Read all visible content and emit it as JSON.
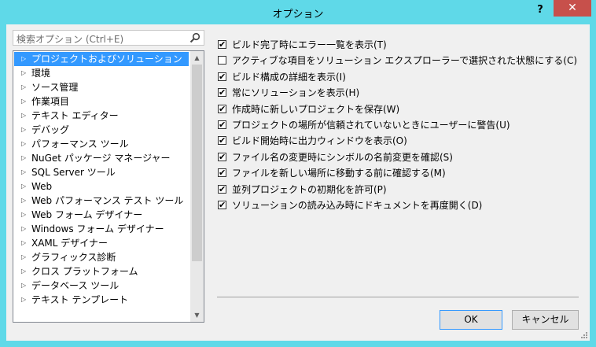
{
  "window": {
    "title": "オプション",
    "help_label": "?",
    "close_label": "✕"
  },
  "search": {
    "placeholder": "検索オプション (Ctrl+E)"
  },
  "tree": {
    "items": [
      {
        "label": "プロジェクトおよびソリューション",
        "selected": true
      },
      {
        "label": "環境"
      },
      {
        "label": "ソース管理"
      },
      {
        "label": "作業項目"
      },
      {
        "label": "テキスト エディター"
      },
      {
        "label": "デバッグ"
      },
      {
        "label": "パフォーマンス ツール"
      },
      {
        "label": "NuGet パッケージ マネージャー"
      },
      {
        "label": "SQL Server ツール"
      },
      {
        "label": "Web"
      },
      {
        "label": "Web パフォーマンス テスト ツール"
      },
      {
        "label": "Web フォーム デザイナー"
      },
      {
        "label": "Windows フォーム デザイナー"
      },
      {
        "label": "XAML デザイナー"
      },
      {
        "label": "グラフィックス診断"
      },
      {
        "label": "クロス プラットフォーム"
      },
      {
        "label": "データベース ツール"
      },
      {
        "label": "テキスト テンプレート"
      }
    ]
  },
  "options": [
    {
      "label": "ビルド完了時にエラー一覧を表示(T)",
      "checked": true
    },
    {
      "label": "アクティブな項目をソリューション エクスプローラーで選択された状態にする(C)",
      "checked": false
    },
    {
      "label": "ビルド構成の詳細を表示(I)",
      "checked": true
    },
    {
      "label": "常にソリューションを表示(H)",
      "checked": true
    },
    {
      "label": "作成時に新しいプロジェクトを保存(W)",
      "checked": true
    },
    {
      "label": "プロジェクトの場所が信頼されていないときにユーザーに警告(U)",
      "checked": true
    },
    {
      "label": "ビルド開始時に出力ウィンドウを表示(O)",
      "checked": true
    },
    {
      "label": "ファイル名の変更時にシンボルの名前変更を確認(S)",
      "checked": true
    },
    {
      "label": "ファイルを新しい場所に移動する前に確認する(M)",
      "checked": true
    },
    {
      "label": "並列プロジェクトの初期化を許可(P)",
      "checked": true
    },
    {
      "label": "ソリューションの読み込み時にドキュメントを再度開く(D)",
      "checked": true
    }
  ],
  "buttons": {
    "ok": "OK",
    "cancel": "キャンセル"
  },
  "colors": {
    "title_bar": "#5fd9e8",
    "close_button": "#c7504b",
    "selection": "#3399ff"
  }
}
